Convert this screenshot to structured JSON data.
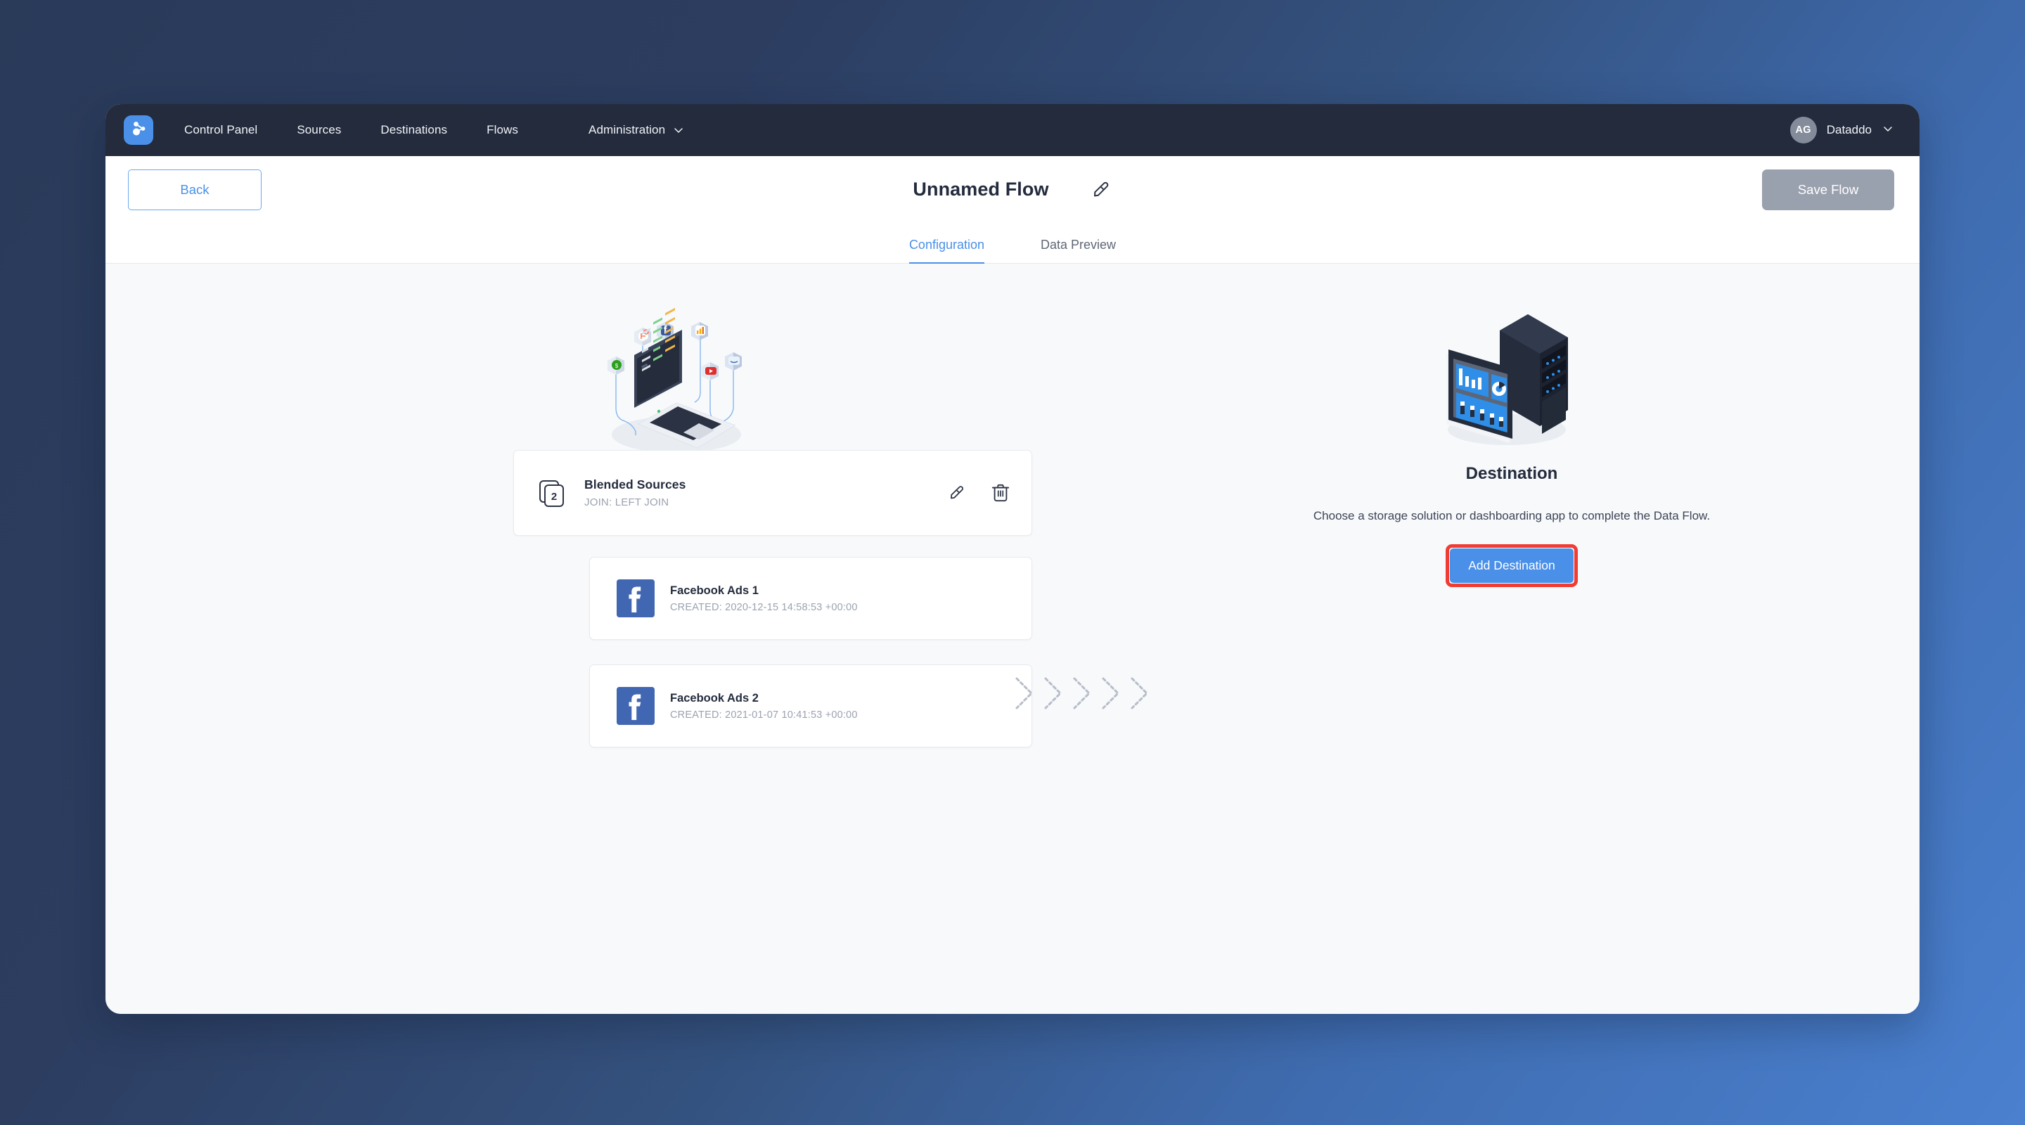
{
  "theme": {
    "accent_blue": "#4a90e8",
    "navbar_bg": "#232b3d",
    "content_bg": "#f7f9fb",
    "highlight_red": "#f03c33",
    "facebook_blue": "#4267b2",
    "muted_text": "#9ba2af"
  },
  "navbar": {
    "logo_icon": "share-nodes-icon",
    "links": [
      {
        "label": "Control Panel",
        "icon": ""
      },
      {
        "label": "Sources",
        "icon": ""
      },
      {
        "label": "Destinations",
        "icon": ""
      },
      {
        "label": "Flows",
        "icon": ""
      },
      {
        "label": "Administration",
        "icon": "chevron-down-icon"
      }
    ],
    "account": {
      "initials": "AG",
      "name": "Dataddo",
      "caret_icon": "chevron-down-icon"
    }
  },
  "header": {
    "back_label": "Back",
    "flow_title": "Unnamed Flow",
    "edit_title_icon": "pencil-icon",
    "save_label": "Save Flow",
    "save_enabled": false
  },
  "tabs": [
    {
      "label": "Configuration",
      "active": true
    },
    {
      "label": "Data Preview",
      "active": false
    }
  ],
  "sources": {
    "illustration": "laptop-with-connected-app-icons-illustration",
    "blended": {
      "count": "2",
      "count_icon": "stacked-cards-icon",
      "title": "Blended Sources",
      "subtitle": "JOIN: LEFT JOIN",
      "edit_icon": "pencil-icon",
      "delete_icon": "trash-icon"
    },
    "items": [
      {
        "icon": "facebook-icon",
        "title": "Facebook Ads 1",
        "subtitle": "CREATED: 2020-12-15 14:58:53 +00:00"
      },
      {
        "icon": "facebook-icon",
        "title": "Facebook Ads 2",
        "subtitle": "CREATED: 2021-01-07 10:41:53 +00:00"
      }
    ]
  },
  "flow_arrows": {
    "icon": "chevron-right-dashed-icon",
    "count": 5
  },
  "destination": {
    "illustration": "server-rack-and-dashboard-tablet-illustration",
    "heading": "Destination",
    "description": "Choose a storage solution or dashboarding app to complete the Data Flow.",
    "add_label": "Add Destination",
    "highlighted": true
  }
}
